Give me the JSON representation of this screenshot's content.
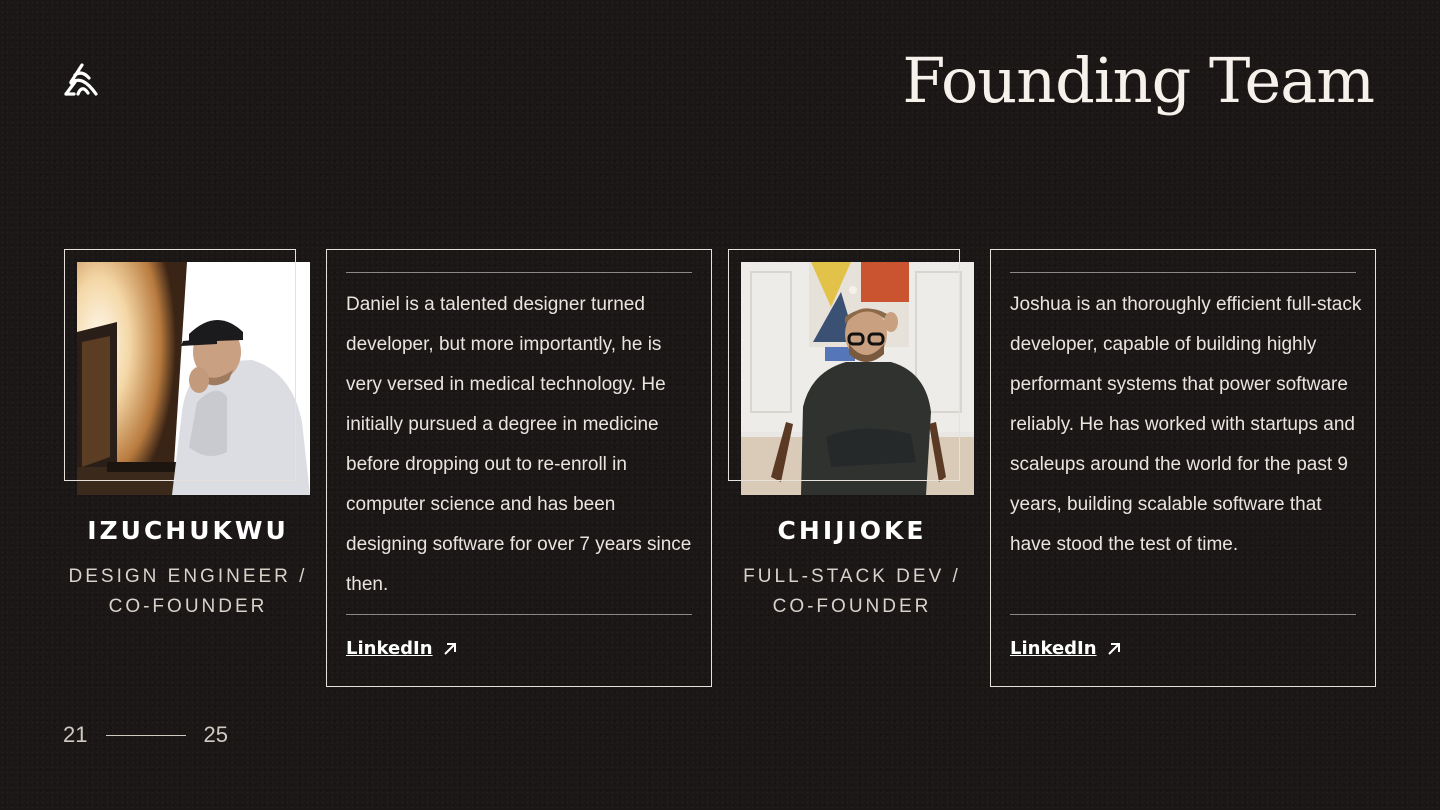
{
  "title": "Founding Team",
  "logo": {
    "icon": "stacked-triangle-logo-icon"
  },
  "members": [
    {
      "name": "IZUCHUKWU",
      "role_line1": "DESIGN ENGINEER /",
      "role_line2": "CO-FOUNDER",
      "bio": "Daniel is a talented designer turned developer, but more importantly, he is very versed in medical technology. He initially pursued a degree in medicine before dropping out to re-enroll in computer science and has been designing software for over 7 years since then.",
      "link_label": "LinkedIn",
      "photo": "man in cap and white hoodie at computer desk"
    },
    {
      "name": "CHIJIOKE",
      "role_line1": "FULL-STACK DEV /",
      "role_line2": "CO-FOUNDER",
      "bio": "Joshua is an thoroughly efficient full-stack developer, capable of building highly performant systems that power software reliably. He has worked with startups and scaleups around the world for the past 9 years, building scalable software that have stood the test of time.",
      "link_label": "LinkedIn",
      "photo": "man with glasses in dark sweater seated on chair"
    }
  ],
  "pagination": {
    "current": "21",
    "total": "25"
  },
  "colors": {
    "background": "#1b1716",
    "text": "#f3eee8",
    "border": "#e6e1da",
    "rule": "#8d8883"
  }
}
